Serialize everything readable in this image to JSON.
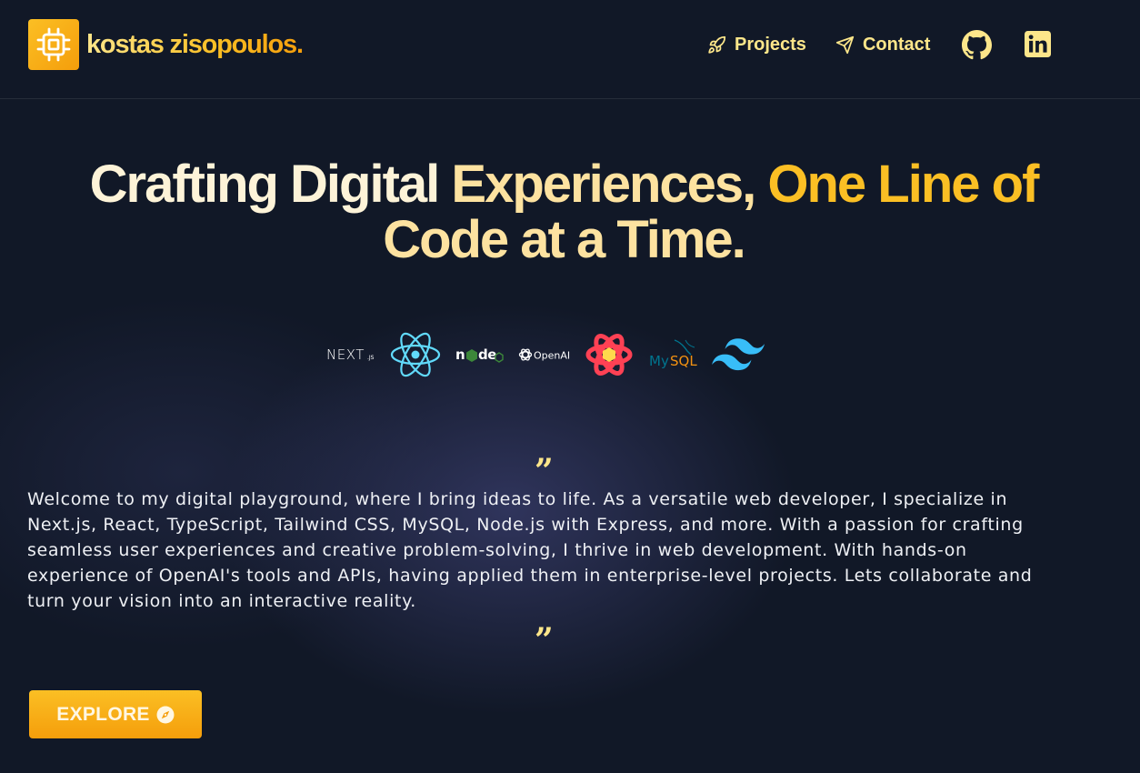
{
  "header": {
    "brand": {
      "name": "kostas zisopoulos.",
      "icon": "cpu-chip-icon"
    },
    "nav": [
      {
        "label": "Projects",
        "icon": "rocket-icon"
      },
      {
        "label": "Contact",
        "icon": "paper-plane-icon"
      }
    ],
    "social": [
      {
        "icon": "github-icon"
      },
      {
        "icon": "linkedin-icon"
      }
    ]
  },
  "hero": {
    "title_part1": "Crafting Digital ",
    "title_part2": "Experiences, ",
    "title_part3": "One Line of",
    "title_part4": "Code at a Time."
  },
  "tech_stack": [
    {
      "name": "NEXT.js",
      "icon": "nextjs-logo"
    },
    {
      "name": "React",
      "icon": "react-logo"
    },
    {
      "name": "node",
      "icon": "nodejs-logo"
    },
    {
      "name": "OpenAI",
      "icon": "openai-logo"
    },
    {
      "name": "React Query",
      "icon": "react-query-logo"
    },
    {
      "name": "MySQL",
      "icon": "mysql-logo"
    },
    {
      "name": "Tailwind CSS",
      "icon": "tailwind-logo"
    }
  ],
  "intro": {
    "quote_open": "”",
    "text": "Welcome to my digital playground, where I bring ideas to life. As a versatile web developer, I specialize in Next.js, React, TypeScript, Tailwind CSS, MySQL, Node.js with Express, and more. With a passion for crafting seamless user experiences and creative problem-solving, I thrive in web development. With hands-on experience of OpenAI's tools and APIs, having applied them in enterprise-level projects. Lets collaborate and turn your vision into an interactive reality.",
    "quote_close": "”"
  },
  "cta": {
    "label": "EXPLORE",
    "icon": "compass-icon"
  },
  "colors": {
    "background": "#111827",
    "accent": "#fbbf24",
    "accent_light": "#fde68a"
  }
}
